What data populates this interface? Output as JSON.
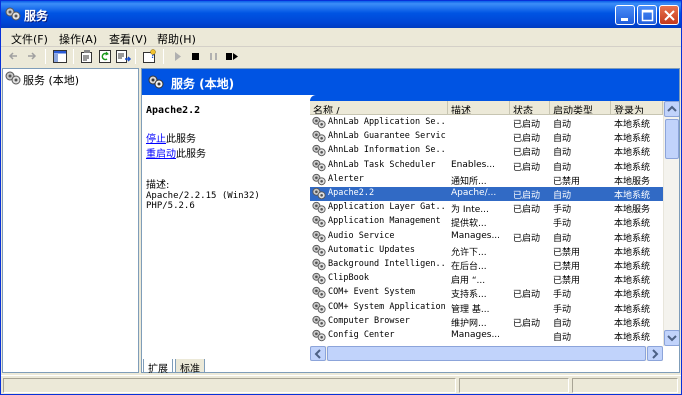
{
  "window": {
    "title": "服务"
  },
  "menu": [
    "文件(F)",
    "操作(A)",
    "查看(V)",
    "帮助(H)"
  ],
  "toolbar": {
    "icons": [
      "back-icon",
      "forward-icon",
      "show-hide-tree-icon",
      "properties-icon",
      "refresh-icon",
      "export-list-icon",
      "help-icon",
      "start-icon",
      "stop-icon",
      "pause-icon",
      "restart-icon"
    ]
  },
  "tree": {
    "root_label": "服务 (本地)"
  },
  "banner": {
    "title": "服务 (本地)"
  },
  "detail": {
    "service_name": "Apache2.2",
    "stop_link": "停止",
    "stop_suffix": "此服务",
    "restart_link": "重启动",
    "restart_suffix": "此服务",
    "desc_label": "描述:",
    "desc_text": "Apache/2.2.15 (Win32) PHP/5.2.6"
  },
  "list": {
    "columns": [
      "名称 /",
      "描述",
      "状态",
      "启动类型",
      "登录为"
    ],
    "rows": [
      {
        "name": "AhnLab Application Se...",
        "desc": "",
        "status": "已启动",
        "startup": "自动",
        "logon": "本地系统"
      },
      {
        "name": "AhnLab Guarantee Service",
        "desc": "",
        "status": "已启动",
        "startup": "自动",
        "logon": "本地系统"
      },
      {
        "name": "AhnLab Information Se...",
        "desc": "",
        "status": "已启动",
        "startup": "自动",
        "logon": "本地系统"
      },
      {
        "name": "AhnLab Task Scheduler",
        "desc": "Enables...",
        "status": "已启动",
        "startup": "自动",
        "logon": "本地系统"
      },
      {
        "name": "Alerter",
        "desc": "通知所...",
        "status": "",
        "startup": "已禁用",
        "logon": "本地服务"
      },
      {
        "name": "Apache2.2",
        "desc": "Apache/...",
        "status": "已启动",
        "startup": "自动",
        "logon": "本地系统",
        "selected": true
      },
      {
        "name": "Application Layer Gat...",
        "desc": "为 Inte...",
        "status": "已启动",
        "startup": "手动",
        "logon": "本地服务"
      },
      {
        "name": "Application Management",
        "desc": "提供软...",
        "status": "",
        "startup": "手动",
        "logon": "本地系统"
      },
      {
        "name": "Audio Service",
        "desc": "Manages...",
        "status": "已启动",
        "startup": "自动",
        "logon": "本地系统"
      },
      {
        "name": "Automatic Updates",
        "desc": "允许下...",
        "status": "",
        "startup": "已禁用",
        "logon": "本地系统"
      },
      {
        "name": "Background Intelligen...",
        "desc": "在后台...",
        "status": "",
        "startup": "已禁用",
        "logon": "本地系统"
      },
      {
        "name": "ClipBook",
        "desc": "启用 “...",
        "status": "",
        "startup": "已禁用",
        "logon": "本地系统"
      },
      {
        "name": "COM+ Event System",
        "desc": "支持系...",
        "status": "已启动",
        "startup": "手动",
        "logon": "本地系统"
      },
      {
        "name": "COM+ System Application",
        "desc": "管理 基...",
        "status": "",
        "startup": "手动",
        "logon": "本地系统"
      },
      {
        "name": "Computer Browser",
        "desc": "维护网...",
        "status": "已启动",
        "startup": "自动",
        "logon": "本地系统"
      },
      {
        "name": "Config Center",
        "desc": "Manages...",
        "status": "",
        "startup": "自动",
        "logon": "本地系统"
      }
    ]
  },
  "tabs": [
    "扩展",
    "标准"
  ],
  "colors": {
    "title_bar": "#0054E3",
    "selection": "#316AC5",
    "link": "#0000FF"
  }
}
